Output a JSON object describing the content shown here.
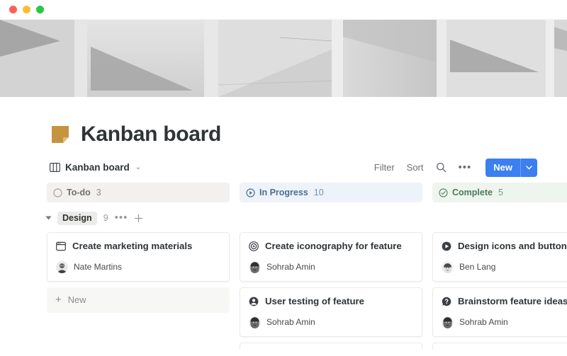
{
  "window": {
    "traffic_lights": [
      {
        "name": "close",
        "color": "#ff5f57"
      },
      {
        "name": "minimize",
        "color": "#febc2e"
      },
      {
        "name": "maximize",
        "color": "#28c840"
      }
    ]
  },
  "cover": {
    "name": "cover-image",
    "description": "grayscale architectural concrete wall photo"
  },
  "page": {
    "icon": "sticky-note-icon",
    "icon_color": "#c5943f",
    "title": "Kanban board"
  },
  "toolbar": {
    "view_icon": "board-columns-icon",
    "view_label": "Kanban board",
    "view_chevron": "⌄",
    "filter_label": "Filter",
    "sort_label": "Sort",
    "search_icon": "search-icon",
    "more_icon": "ellipsis-icon",
    "more_label": "•••",
    "new_label": "New",
    "new_chevron": "⌄",
    "accent_color": "#3b7ff0"
  },
  "board": {
    "columns": [
      {
        "id": "todo",
        "label": "To-do",
        "count": "3",
        "icon": "circle-outline-icon",
        "icon_color": "#9b9a97",
        "tint": "#f2f1f0",
        "text_color": "#6f6f6e"
      },
      {
        "id": "progress",
        "label": "In Progress",
        "count": "10",
        "icon": "play-circle-outline-icon",
        "icon_color": "#4a6f96",
        "tint": "#eef3fa",
        "text_color": "#4a6f96"
      },
      {
        "id": "complete",
        "label": "Complete",
        "count": "5",
        "icon": "check-circle-outline-icon",
        "icon_color": "#4e7a58",
        "tint": "#eef5ef",
        "text_color": "#4e7a58"
      }
    ],
    "group": {
      "collapse_icon": "triangle-down-icon",
      "name": "Design",
      "count": "9",
      "more_label": "•••",
      "add_label": "+"
    },
    "add_card_label": "New",
    "add_card_plus": "+",
    "cards": {
      "todo": [
        {
          "icon": "browser-window-icon",
          "title": "Create marketing materials",
          "assignee": "Nate Martins",
          "avatar": "avatar-nate-martins"
        }
      ],
      "progress": [
        {
          "icon": "target-icon",
          "title": "Create iconography for feature",
          "assignee": "Sohrab Amin",
          "avatar": "avatar-sohrab-amin"
        },
        {
          "icon": "account-circle-icon",
          "title": "User testing of feature",
          "assignee": "Sohrab Amin",
          "avatar": "avatar-sohrab-amin"
        }
      ],
      "complete": [
        {
          "icon": "play-circle-filled-icon",
          "title": "Design icons and buttons",
          "assignee": "Ben Lang",
          "avatar": "avatar-ben-lang"
        },
        {
          "icon": "question-bubble-icon",
          "title": "Brainstorm feature ideas",
          "assignee": "Sohrab Amin",
          "avatar": "avatar-sohrab-amin"
        }
      ]
    }
  }
}
